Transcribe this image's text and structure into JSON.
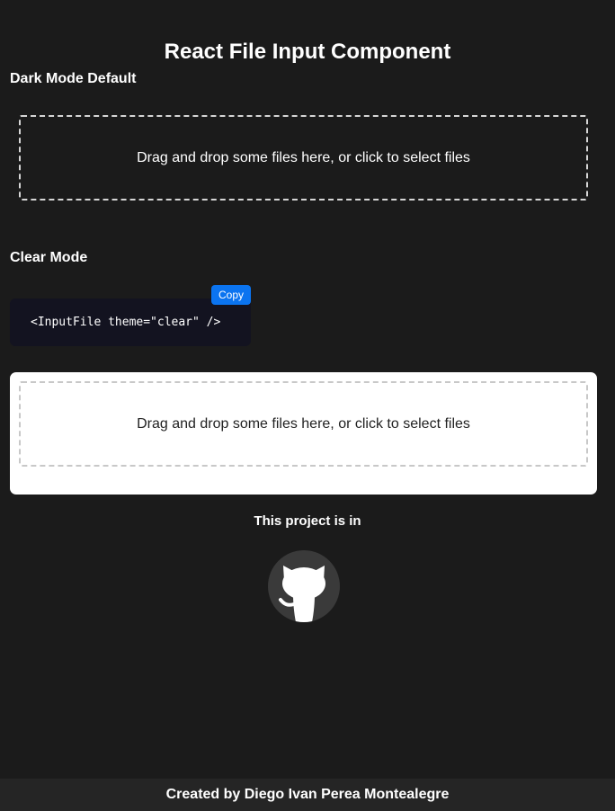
{
  "page": {
    "title": "React File Input Component"
  },
  "dark_section": {
    "title": "Dark Mode Default",
    "dropzone_text": "Drag and drop some files here, or click to select files"
  },
  "clear_section": {
    "title": "Clear Mode",
    "code": "<InputFile theme=\"clear\" />",
    "copy_label": "Copy",
    "dropzone_text": "Drag and drop some files here, or click to select files"
  },
  "project": {
    "text": "This project is in",
    "icon": "github-icon"
  },
  "footer": {
    "text": "Created by Diego Ivan Perea Montealegre"
  },
  "colors": {
    "background": "#1b1b1b",
    "footer_background": "#252525",
    "code_background": "#131320",
    "copy_button": "#0b74f0",
    "clear_card": "#ffffff",
    "github_circle": "#3a3a3a"
  }
}
